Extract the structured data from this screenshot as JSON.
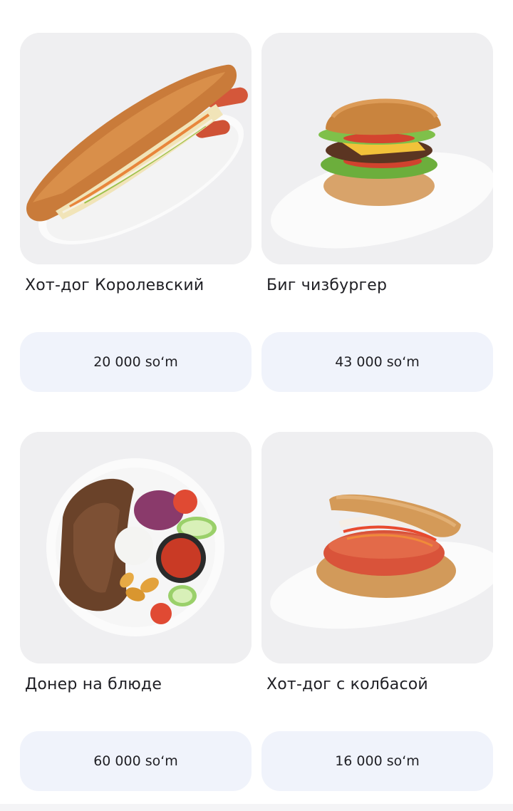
{
  "products": [
    {
      "name": "Хот-дог Королевский",
      "price": "20 000 so‘m",
      "image_icon": "hotdog-icon"
    },
    {
      "name": "Биг чизбургер",
      "price": "43 000 so‘m",
      "image_icon": "cheeseburger-icon"
    },
    {
      "name": "Донер на блюде",
      "price": "60 000 so‘m",
      "image_icon": "doner-plate-icon"
    },
    {
      "name": "Хот-дог с колбасой",
      "price": "16 000 so‘m",
      "image_icon": "sausage-burger-icon"
    }
  ],
  "colors": {
    "card_bg": "#efeff1",
    "price_bg": "#f0f3fb",
    "text": "#1f1f24"
  }
}
